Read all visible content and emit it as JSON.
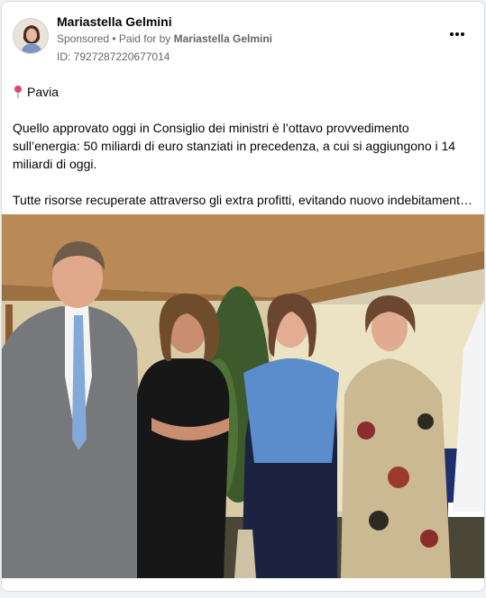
{
  "post": {
    "author": "Mariastella Gelmini",
    "sponsored": "Sponsored",
    "paid_prefix": " • Paid for by ",
    "paid_by": "Mariastella Gelmini",
    "ad_id": "ID: 7927287220677014",
    "location": "Pavia",
    "paragraph1": "Quello approvato oggi in Consiglio dei ministri è l’ottavo provvedimento sull’energia: 50 miliardi di euro stanziati in precedenza, a cui si aggiungono i 14 miliardi di oggi.",
    "paragraph2": "Tutte risorse recuperate attraverso gli extra profitti, evitando nuovo indebitament…"
  },
  "icons": {
    "more": "more-options-icon",
    "location": "location-pin-icon"
  },
  "colors": {
    "card_bg": "#ffffff",
    "secondary_text": "#65676b",
    "pin": "#e0457b"
  }
}
